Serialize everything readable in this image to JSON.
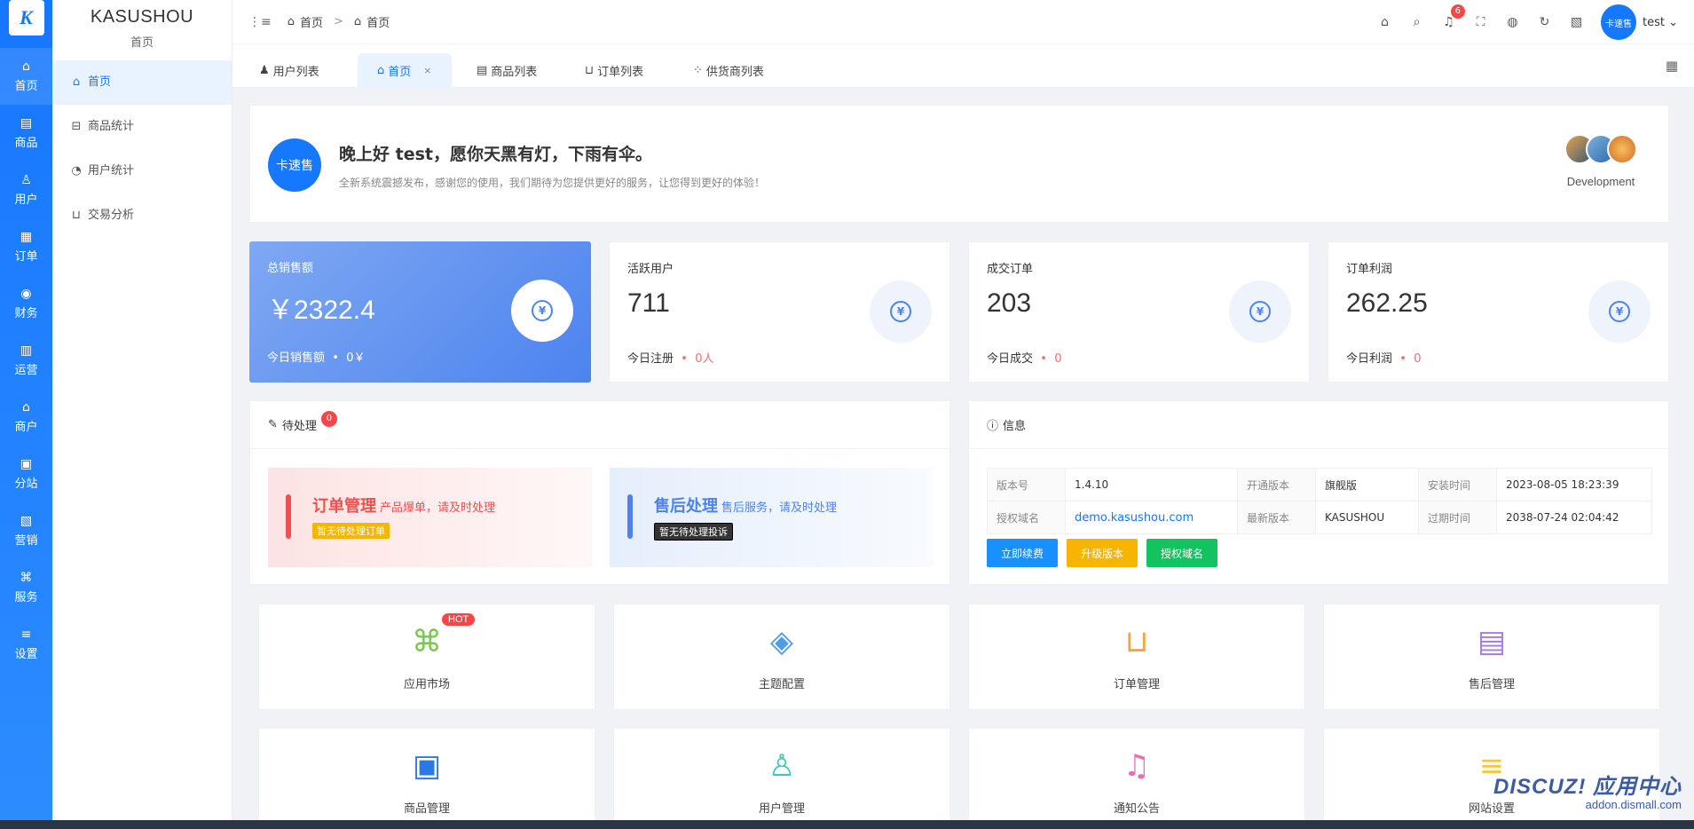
{
  "rail": {
    "logo": "K",
    "items": [
      {
        "label": "首页",
        "icon": "home-icon",
        "glyph": "⌂"
      },
      {
        "label": "商品",
        "icon": "box-icon",
        "glyph": "▤"
      },
      {
        "label": "用户",
        "icon": "user-icon",
        "glyph": "♙"
      },
      {
        "label": "订单",
        "icon": "order-icon",
        "glyph": "▦"
      },
      {
        "label": "财务",
        "icon": "finance-icon",
        "glyph": "◉"
      },
      {
        "label": "运营",
        "icon": "operation-icon",
        "glyph": "▥"
      },
      {
        "label": "商户",
        "icon": "shop-icon",
        "glyph": "⌂"
      },
      {
        "label": "分站",
        "icon": "station-icon",
        "glyph": "▣"
      },
      {
        "label": "营销",
        "icon": "gift-icon",
        "glyph": "▧"
      },
      {
        "label": "服务",
        "icon": "command-icon",
        "glyph": "⌘"
      },
      {
        "label": "设置",
        "icon": "sliders-icon",
        "glyph": "≡"
      }
    ]
  },
  "sidebar": {
    "title": "KASUSHOU",
    "subtitle": "首页",
    "items": [
      {
        "label": "首页",
        "glyph": "⌂"
      },
      {
        "label": "商品统计",
        "glyph": "⊟"
      },
      {
        "label": "用户统计",
        "glyph": "◔"
      },
      {
        "label": "交易分析",
        "glyph": "⊔"
      }
    ]
  },
  "header": {
    "breadcrumb": [
      "首页",
      "首页"
    ],
    "bell_count": "6",
    "user_avatar": "卡速售",
    "user_name": "test"
  },
  "tabs": [
    {
      "label": "用户列表",
      "glyph": "♟"
    },
    {
      "label": "首页",
      "glyph": "⌂",
      "close": "×"
    },
    {
      "label": "商品列表",
      "glyph": "▤"
    },
    {
      "label": "订单列表",
      "glyph": "⊔"
    },
    {
      "label": "供货商列表",
      "glyph": "⁘"
    }
  ],
  "welcome": {
    "logo_text": "卡速售",
    "title": "晚上好 test，愿你天黑有灯，下雨有伞。",
    "desc": "全新系统震撼发布，感谢您的使用，我们期待为您提供更好的服务，让您得到更好的体验！",
    "team_label": "Development"
  },
  "stats": [
    {
      "label": "总销售额",
      "value": "￥2322.4",
      "foot_label": "今日销售额",
      "foot_dot": "•",
      "foot_value": "0￥"
    },
    {
      "label": "活跃用户",
      "value": "711",
      "foot_label": "今日注册",
      "foot_dot": "•",
      "foot_value": "0人"
    },
    {
      "label": "成交订单",
      "value": "203",
      "foot_label": "今日成交",
      "foot_dot": "•",
      "foot_value": "0"
    },
    {
      "label": "订单利润",
      "value": "262.25",
      "foot_label": "今日利润",
      "foot_dot": "•",
      "foot_value": "0"
    }
  ],
  "pending": {
    "title": "待处理",
    "badge": "0",
    "items": [
      {
        "title": "订单管理",
        "sub": "产品爆单，请及时处理",
        "tag": "暂无待处理订单"
      },
      {
        "title": "售后处理",
        "sub": "售后服务，请及时处理",
        "tag": "暂无待处理投诉"
      }
    ]
  },
  "info": {
    "title": "信息",
    "rows": [
      [
        "版本号",
        "1.4.10",
        "开通版本",
        "旗舰版",
        "安装时间",
        "2023-08-05 18:23:39"
      ],
      [
        "授权域名",
        "demo.kasushou.com",
        "最新版本",
        "KASUSHOU",
        "过期时间",
        "2038-07-24 02:04:42"
      ]
    ],
    "buttons": [
      "立即续费",
      "升级版本",
      "授权域名"
    ]
  },
  "tiles": [
    {
      "label": "应用市场",
      "glyph": "⌘",
      "color": "#7ac74f",
      "hot": "HOT"
    },
    {
      "label": "主题配置",
      "glyph": "◈",
      "color": "#4c9be8"
    },
    {
      "label": "订单管理",
      "glyph": "⊔",
      "color": "#f7a440"
    },
    {
      "label": "售后管理",
      "glyph": "▤",
      "color": "#a57be0"
    },
    {
      "label": "商品管理",
      "glyph": "▣",
      "color": "#2a7ae2"
    },
    {
      "label": "用户管理",
      "glyph": "♙",
      "color": "#3ec8b8"
    },
    {
      "label": "通知公告",
      "glyph": "♫",
      "color": "#e86fb0"
    },
    {
      "label": "网站设置",
      "glyph": "≡",
      "color": "#f5c542"
    }
  ],
  "watermark": {
    "title": "DISCUZ! 应用中心",
    "sub": "addon.dismall.com"
  }
}
